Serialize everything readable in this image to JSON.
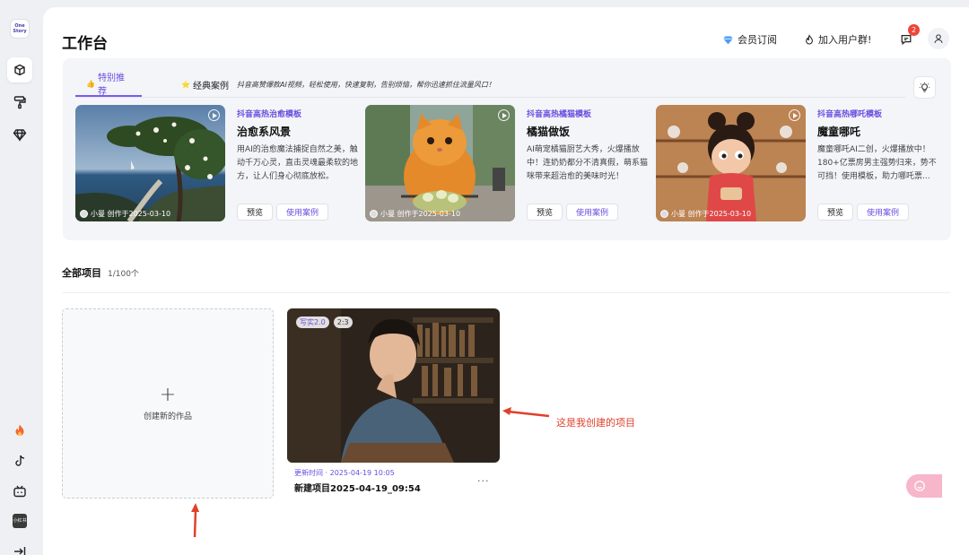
{
  "app": {
    "logo_text": "One Story"
  },
  "sidebar": {
    "items": [
      {
        "icon": "box-icon"
      },
      {
        "icon": "paint-roller-icon"
      },
      {
        "icon": "diamond-icon"
      },
      {
        "icon": "fire-icon"
      },
      {
        "icon": "tiktok-icon"
      },
      {
        "icon": "bilibili-icon"
      },
      {
        "icon": "xiaohongshu-icon",
        "label": "小红书"
      },
      {
        "icon": "collapse-icon"
      }
    ]
  },
  "header": {
    "title": "工作台",
    "membership_label": "会员订阅",
    "join_group_label": "加入用户群!",
    "message_badge": "2"
  },
  "featured": {
    "tabs": [
      {
        "label": "特别推荐",
        "icon": "👍"
      },
      {
        "label": "经典案例",
        "icon": "⭐"
      }
    ],
    "description": "抖音高赞爆款AI视频，轻松使用，快速复制，告别烦恼，帮你迅速抓住流量风口！",
    "preview_label": "预览",
    "case_label": "使用案例",
    "cards": [
      {
        "tag": "抖音高热治愈模板",
        "title": "治愈系风景",
        "desc": "用AI的治愈魔法捕捉自然之美，触动千万心灵，直击灵魂最柔软的地方，让人们身心彻底放松。",
        "meta": "小曼 创作于2025-03-10"
      },
      {
        "tag": "抖音高热橘猫模板",
        "title": "橘猫做饭",
        "desc": "AI萌宠橘猫厨艺大秀，火爆播放中！连奶奶都分不清真假，萌系猫咪带来超治愈的美味时光！",
        "meta": "小曼 创作于2025-03-10"
      },
      {
        "tag": "抖音高热哪吒模板",
        "title": "魔童哪吒",
        "desc": "魔童哪吒AI二创，火爆播放中！180+亿票房男主强势归来，势不可挡！使用模板，助力哪吒票...",
        "meta": "小曼 创作于2025-03-10"
      }
    ]
  },
  "projects": {
    "title": "全部项目",
    "count": "1/100个",
    "create_label": "创建新的作品",
    "items": [
      {
        "tags": [
          "写实2.0",
          "2:3"
        ],
        "updated": "更新时间 · 2025-04-19 10:05",
        "name": "新建项目2025-04-19_09:54",
        "more": "···"
      }
    ]
  },
  "annotation": {
    "text": "这是我创建的项目"
  },
  "colors": {
    "accent": "#6a4de0",
    "annotation": "#e0402a",
    "badge": "#f04438"
  }
}
